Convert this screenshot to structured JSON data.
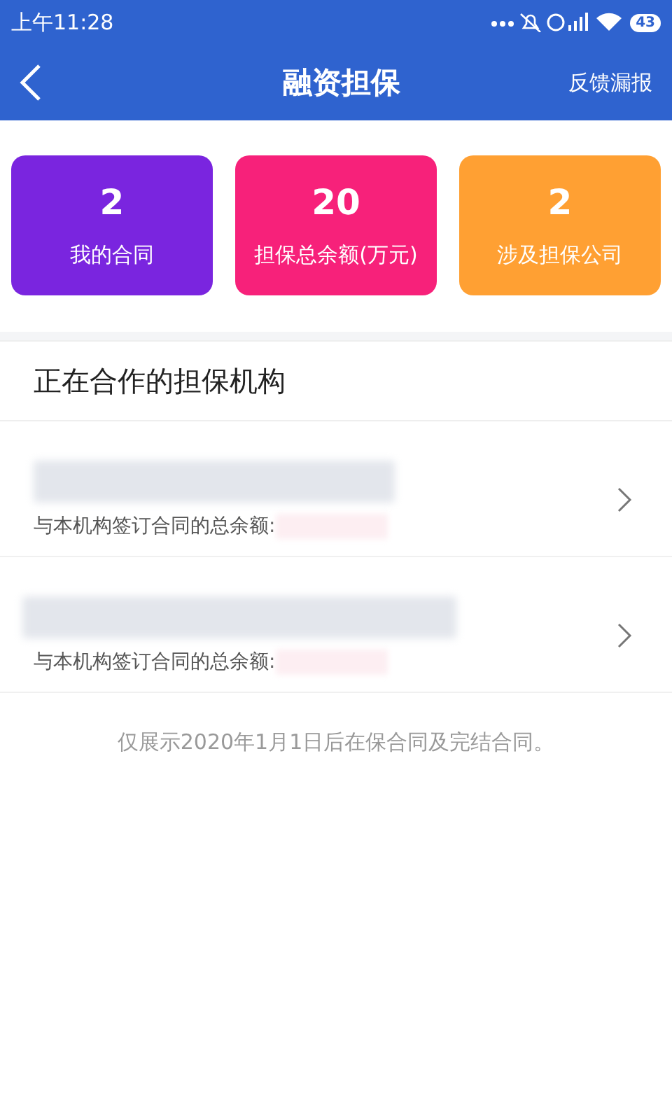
{
  "status_bar": {
    "time": "上午11:28",
    "battery": "43"
  },
  "nav": {
    "title": "融资担保",
    "action": "反馈漏报"
  },
  "stats": [
    {
      "value": "2",
      "label": "我的合同",
      "color": "#7a25df"
    },
    {
      "value": "20",
      "label": "担保总余额(万元)",
      "color": "#f7217a"
    },
    {
      "value": "2",
      "label": "涉及担保公司",
      "color": "#ffa033"
    }
  ],
  "section": {
    "title": "正在合作的担保机构"
  },
  "institutions": [
    {
      "amount_label": "与本机构签订合同的总余额:"
    },
    {
      "amount_label": "与本机构签订合同的总余额:"
    }
  ],
  "footnote": "仅展示2020年1月1日后在保合同及完结合同。"
}
